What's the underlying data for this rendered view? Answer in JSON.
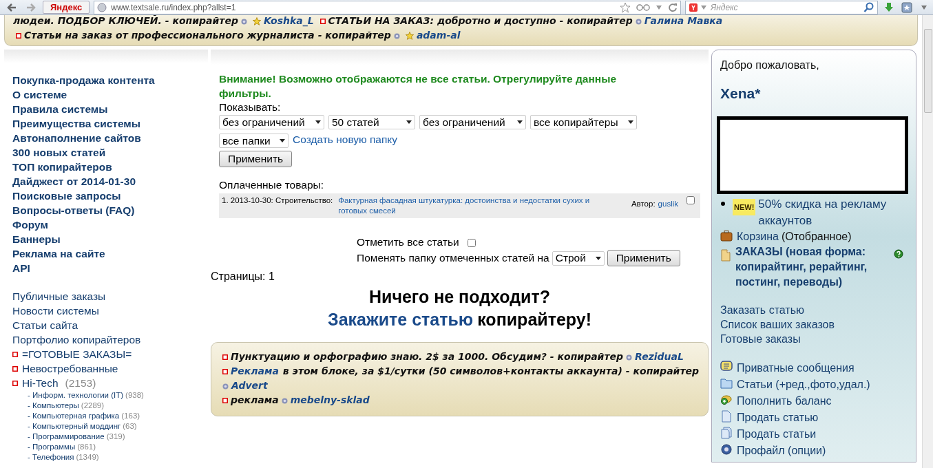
{
  "browser": {
    "search_engine": "Яндекс",
    "url": "www.textsale.ru/index.php?allst=1",
    "search_placeholder": "Яндекс"
  },
  "top_ads": [
    {
      "marker": false,
      "text": "людеи. ПОДБОР КЛЮЧЕЙ. - копирайтер",
      "author": "Koshka_L",
      "star": true
    },
    {
      "marker": true,
      "text": "СТАТЬИ НА ЗАКАЗ: добротно и доступно - копирайтер",
      "author": "Галина Мавка",
      "star": false
    },
    {
      "marker": true,
      "text": "Статьи на заказ от профессионального журналиста - копирайтер",
      "author": "adam-al",
      "star": true
    }
  ],
  "nav_main": [
    "Покупка-продажа контента",
    "О системе",
    "Правила системы",
    "Преимущества системы",
    "Автонаполнение сайтов",
    "300 новых статей",
    "ТОП копирайтеров",
    "Дайджест от 2014-01-30",
    "Поисковые запросы",
    "Вопросы-ответы (FAQ)",
    "Форум",
    "Баннеры",
    "Реклама на сайте",
    "API"
  ],
  "nav_secondary": [
    "Публичные заказы",
    "Новости системы",
    "Статьи сайта",
    "Портфолио копирайтеров"
  ],
  "categories": [
    {
      "label": "=ГОТОВЫЕ ЗАКАЗЫ="
    },
    {
      "label": "Невостребованные"
    },
    {
      "label": "Hi-Tech",
      "count": "(2153)",
      "children": [
        {
          "label": "- Информ. технологии (IT)",
          "count": "(938)"
        },
        {
          "label": "- Компьютеры",
          "count": "(2289)"
        },
        {
          "label": "- Компьютерная графика",
          "count": "(163)"
        },
        {
          "label": "- Компьютерный моддинг",
          "count": "(63)"
        },
        {
          "label": "- Программирование",
          "count": "(319)"
        },
        {
          "label": "- Программы",
          "count": "(861)"
        },
        {
          "label": "- Телефония",
          "count": "(1349)"
        }
      ]
    }
  ],
  "filters": {
    "warning": "Внимание! Возможно отображаются не все статьи. Отрегулируйте данные фильтры.",
    "label": "Показывать:",
    "selects": [
      "без ограничений",
      "50 статей",
      "без ограничений",
      "все копирайтеры",
      "все папки"
    ],
    "new_folder_link": "Создать новую папку",
    "apply": "Применить"
  },
  "paid": {
    "label": "Оплаченные товары:",
    "rows": [
      {
        "number": "1.",
        "date": "2013-10-30:",
        "category": "Строительство:",
        "title": "Фактурная фасадная штукатурка: достоинства и недостатки сухих и готовых смесей",
        "author_label": "Автор:",
        "author": "guslik",
        "checked": false
      }
    ]
  },
  "bulk": {
    "mark_all": "Отметить все статьи",
    "mark_all_checked": false,
    "move_label": "Поменять папку отмеченных статей на",
    "folder": "Строй",
    "apply": "Применить"
  },
  "pages": "Страницы: 1",
  "cta": {
    "text1": "Ничего не подходит?",
    "link": "Закажите статью",
    "text2": "копирайтеру!"
  },
  "bottom_ads": [
    {
      "text": "Пунктуацию и орфографию знаю. 2$ за 1000. Обсудим? - копирайтер",
      "author": "ReziduaL"
    },
    {
      "link": "Реклама",
      "text": "в этом блоке, за $1/сутки (50 символов+контакты аккаунта) - копирайтер",
      "author": "Advert"
    },
    {
      "text": "реклама",
      "author": "mebelny-sklad"
    }
  ],
  "user": {
    "welcome": "Добро пожаловать,",
    "name": "Xena*",
    "promo": {
      "badge": "NEW!",
      "text": "50% скидка на рекламу аккаунтов"
    },
    "basket": {
      "link": "Корзина",
      "note": "(Отобранное)"
    },
    "orders": "ЗАКАЗЫ (новая форма: копирайтинг, рерайтинг, постинг, переводы)",
    "links": [
      "Заказать статью",
      "Список ваших заказов",
      "Готовые заказы"
    ],
    "menu": [
      {
        "kind": "message",
        "label": "Приватные сообщения"
      },
      {
        "kind": "folder",
        "label": "Статьи (+ред.,фото,удал.)"
      },
      {
        "kind": "money",
        "label": "Пополнить баланс"
      },
      {
        "kind": "page",
        "label": "Продать статью"
      },
      {
        "kind": "pages",
        "label": "Продать статьи"
      },
      {
        "kind": "profile",
        "label": "Профайл (опции)"
      }
    ]
  }
}
